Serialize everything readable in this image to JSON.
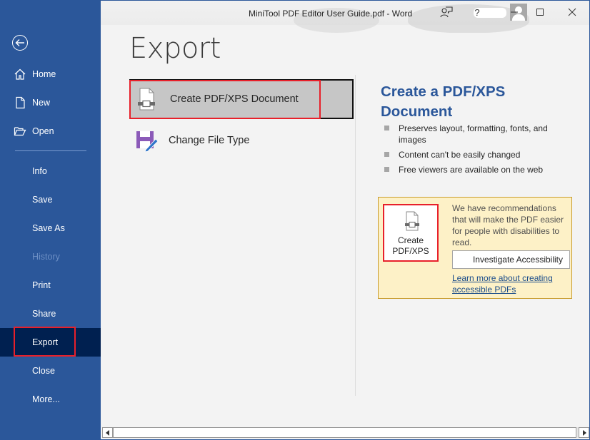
{
  "window": {
    "title": "MiniTool PDF Editor User Guide.pdf  -  Word",
    "controls": {
      "minimize": "minimize-icon",
      "maximize": "maximize-icon",
      "close": "close-icon",
      "help": "?"
    }
  },
  "sidebar": {
    "back": "back-arrow-icon",
    "items": [
      {
        "label": "Home",
        "icon": "home-icon"
      },
      {
        "label": "New",
        "icon": "new-document-icon"
      },
      {
        "label": "Open",
        "icon": "folder-open-icon"
      },
      {
        "label": "Info"
      },
      {
        "label": "Save"
      },
      {
        "label": "Save As"
      },
      {
        "label": "History",
        "disabled": true
      },
      {
        "label": "Print"
      },
      {
        "label": "Share"
      },
      {
        "label": "Export",
        "selected": true
      },
      {
        "label": "Close"
      },
      {
        "label": "More..."
      }
    ]
  },
  "main": {
    "title": "Export",
    "options": [
      {
        "label": "Create PDF/XPS Document",
        "icon": "pdf-document-icon",
        "selected": true
      },
      {
        "label": "Change File Type",
        "icon": "save-edit-icon"
      }
    ],
    "detail": {
      "title": "Create a PDF/XPS Document",
      "bullets": [
        "Preserves layout, formatting, fonts, and images",
        "Content can't be easily changed",
        "Free viewers are available on the web"
      ]
    },
    "accessibility": {
      "create_button_line1": "Create",
      "create_button_line2": "PDF/XPS",
      "message": "We have recommendations that will make the PDF easier for people with disabilities to read.",
      "investigate_button": "Investigate Accessibility",
      "learn_more_link": "Learn more about creating accessible PDFs"
    }
  },
  "colors": {
    "sidebar": "#2b579a",
    "sidebar_selected": "#002050",
    "accent_title": "#2b579a",
    "highlight_red": "#e8202a",
    "panel_bg": "#fdf1c7"
  }
}
